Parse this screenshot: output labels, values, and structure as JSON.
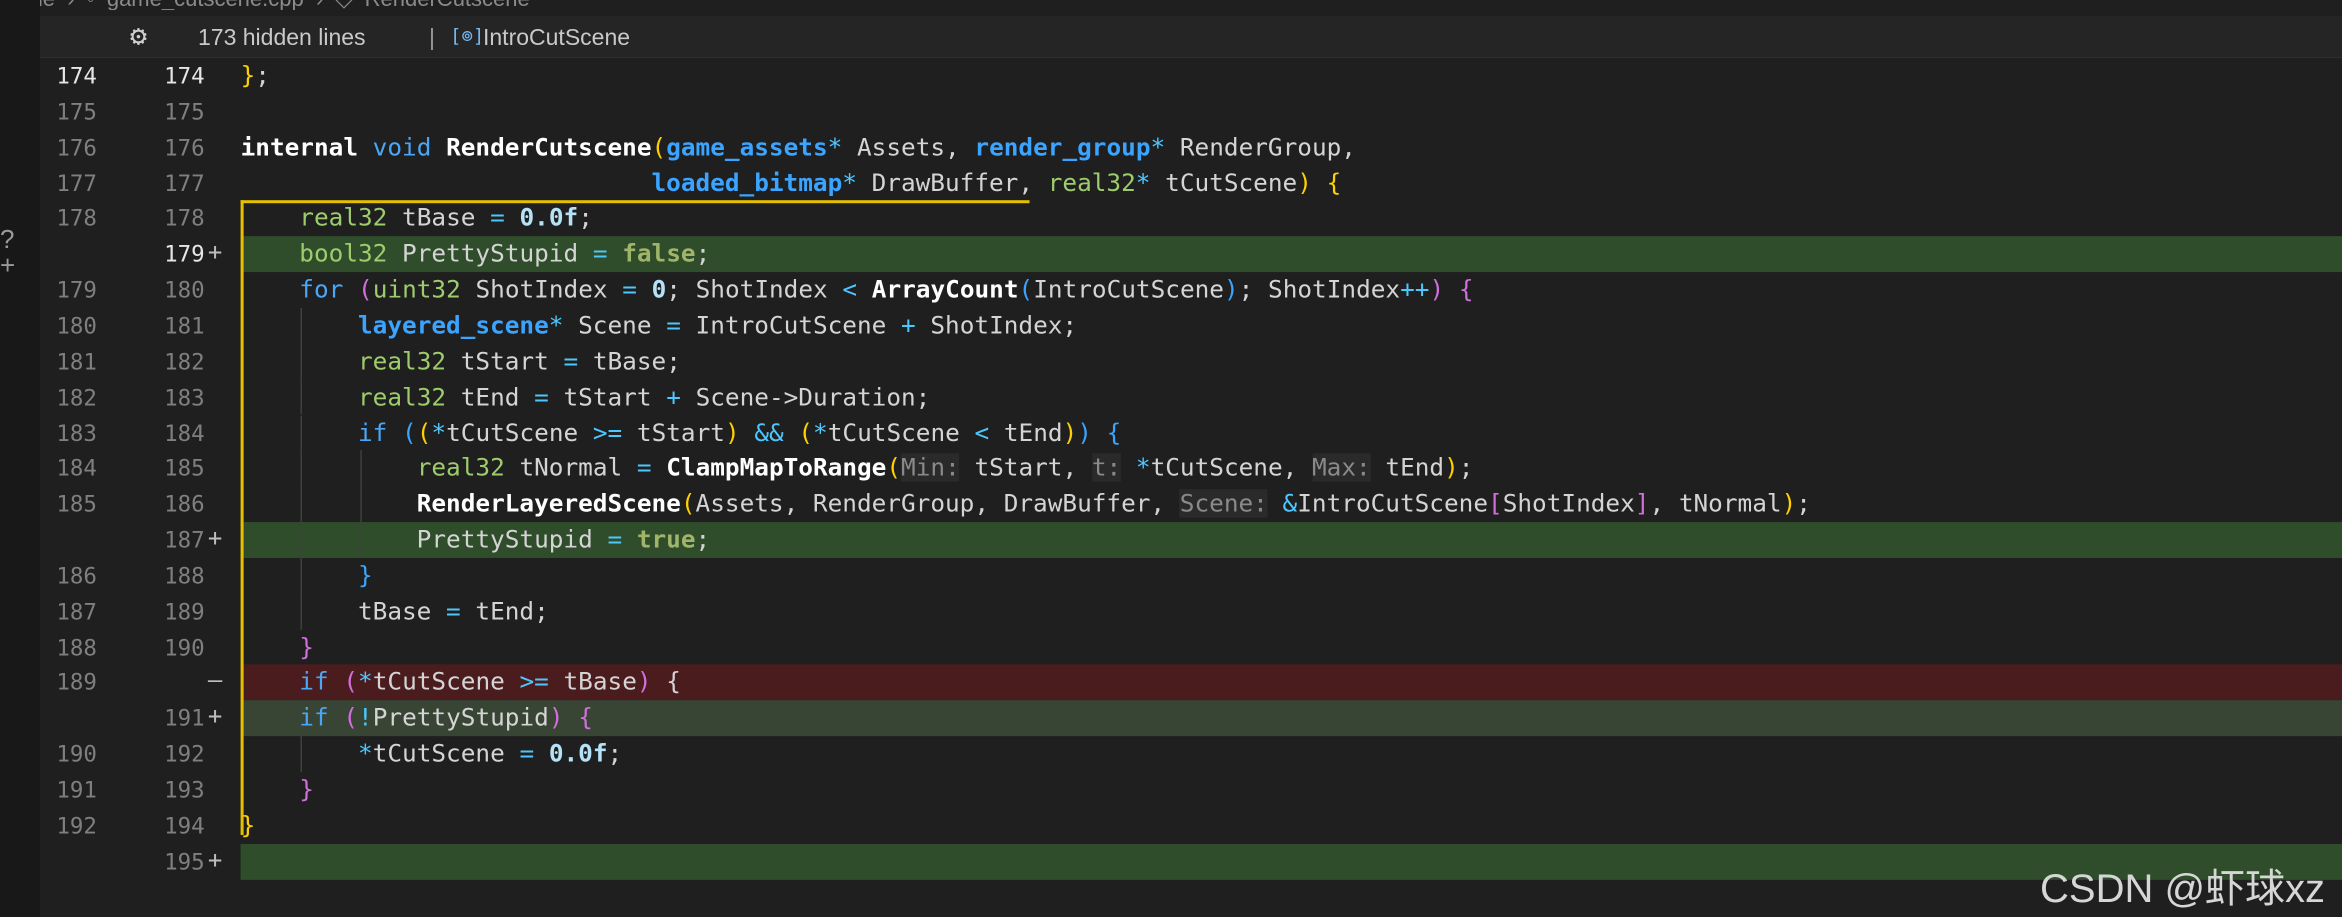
{
  "breadcrumb": "game  ›  ◦  game_cutscene.cpp  ›  ◇  RenderCutscene",
  "sticky": {
    "gear": "⚙",
    "hidden_lines": "173 hidden lines",
    "separator": "|",
    "symbol_icon": "[⊚]",
    "symbol": "IntroCutScene"
  },
  "side_glyph": "?\n+",
  "rows": [
    {
      "a": "174",
      "b": "174",
      "mark": "",
      "type": "normal",
      "cur": true,
      "indent": 0
    },
    {
      "a": "175",
      "b": "175",
      "mark": "",
      "type": "normal",
      "indent": 0
    },
    {
      "a": "176",
      "b": "176",
      "mark": "",
      "type": "normal",
      "indent": 0
    },
    {
      "a": "177",
      "b": "177",
      "mark": "",
      "type": "normal",
      "indent": 0
    },
    {
      "a": "178",
      "b": "178",
      "mark": "",
      "type": "normal",
      "indent": 1
    },
    {
      "a": "",
      "b": "179",
      "mark": "+",
      "type": "added",
      "cur": true,
      "indent": 1
    },
    {
      "a": "179",
      "b": "180",
      "mark": "",
      "type": "normal",
      "indent": 1
    },
    {
      "a": "180",
      "b": "181",
      "mark": "",
      "type": "normal",
      "indent": 2
    },
    {
      "a": "181",
      "b": "182",
      "mark": "",
      "type": "normal",
      "indent": 2
    },
    {
      "a": "182",
      "b": "183",
      "mark": "",
      "type": "normal",
      "indent": 2
    },
    {
      "a": "183",
      "b": "184",
      "mark": "",
      "type": "normal",
      "indent": 2
    },
    {
      "a": "184",
      "b": "185",
      "mark": "",
      "type": "normal",
      "indent": 3
    },
    {
      "a": "185",
      "b": "186",
      "mark": "",
      "type": "normal",
      "indent": 3
    },
    {
      "a": "",
      "b": "187",
      "mark": "+",
      "type": "added",
      "indent": 3
    },
    {
      "a": "186",
      "b": "188",
      "mark": "",
      "type": "normal",
      "indent": 2
    },
    {
      "a": "187",
      "b": "189",
      "mark": "",
      "type": "normal",
      "indent": 2
    },
    {
      "a": "188",
      "b": "190",
      "mark": "",
      "type": "normal",
      "indent": 1
    },
    {
      "a": "189",
      "b": "",
      "mark": "—",
      "type": "removed",
      "indent": 1
    },
    {
      "a": "",
      "b": "191",
      "mark": "+",
      "type": "addedsoft",
      "indent": 1
    },
    {
      "a": "190",
      "b": "192",
      "mark": "",
      "type": "normal",
      "indent": 2
    },
    {
      "a": "191",
      "b": "193",
      "mark": "",
      "type": "normal",
      "indent": 1
    },
    {
      "a": "192",
      "b": "194",
      "mark": "",
      "type": "normal",
      "indent": 0
    },
    {
      "a": "",
      "b": "195",
      "mark": "+",
      "type": "added",
      "indent": 0
    }
  ],
  "code": [
    [
      [
        "t-p1",
        "}"
      ],
      [
        "",
        ";"
      ]
    ],
    [],
    [
      [
        "t-kwb",
        "internal"
      ],
      [
        "",
        " "
      ],
      [
        "t-kw",
        "void"
      ],
      [
        "",
        " "
      ],
      [
        "t-fn",
        "RenderCutscene"
      ],
      [
        "t-p1",
        "("
      ],
      [
        "t-tyb",
        "game_assets"
      ],
      [
        "t-op",
        "*"
      ],
      [
        "",
        " Assets, "
      ],
      [
        "t-tyb",
        "render_group"
      ],
      [
        "t-op",
        "*"
      ],
      [
        "",
        " RenderGroup,"
      ]
    ],
    [
      [
        "",
        "                            "
      ],
      [
        "t-tyb",
        "loaded_bitmap"
      ],
      [
        "t-op",
        "*"
      ],
      [
        "",
        " DrawBuffer, "
      ],
      [
        "t-ty",
        "real32"
      ],
      [
        "t-op",
        "*"
      ],
      [
        "",
        " tCutScene"
      ],
      [
        "t-p1",
        ")"
      ],
      [
        "",
        " "
      ],
      [
        "t-p1",
        "{"
      ]
    ],
    [
      [
        "",
        "    "
      ],
      [
        "t-ty",
        "real32"
      ],
      [
        "",
        " tBase "
      ],
      [
        "t-op",
        "="
      ],
      [
        "",
        " "
      ],
      [
        "t-num",
        "0.0f"
      ],
      [
        "",
        ";"
      ]
    ],
    [
      [
        "",
        "    "
      ],
      [
        "t-ty",
        "bool32"
      ],
      [
        "",
        " PrettyStupid "
      ],
      [
        "t-op",
        "="
      ],
      [
        "",
        " "
      ],
      [
        "t-bool",
        "false"
      ],
      [
        "",
        ";"
      ]
    ],
    [
      [
        "",
        "    "
      ],
      [
        "t-kw",
        "for"
      ],
      [
        "",
        " "
      ],
      [
        "t-p2",
        "("
      ],
      [
        "t-ty",
        "uint32"
      ],
      [
        "",
        " ShotIndex "
      ],
      [
        "t-op",
        "="
      ],
      [
        "",
        " "
      ],
      [
        "t-num",
        "0"
      ],
      [
        "",
        "; ShotIndex "
      ],
      [
        "t-op",
        "<"
      ],
      [
        "",
        " "
      ],
      [
        "t-fn",
        "ArrayCount"
      ],
      [
        "t-p3",
        "("
      ],
      [
        "",
        "IntroCutScene"
      ],
      [
        "t-p3",
        ")"
      ],
      [
        "",
        "; ShotIndex"
      ],
      [
        "t-op",
        "++"
      ],
      [
        "t-p2",
        ")"
      ],
      [
        "",
        " "
      ],
      [
        "t-p2",
        "{"
      ]
    ],
    [
      [
        "",
        "        "
      ],
      [
        "t-tyb",
        "layered_scene"
      ],
      [
        "t-op",
        "*"
      ],
      [
        "",
        " Scene "
      ],
      [
        "t-op",
        "="
      ],
      [
        "",
        " IntroCutScene "
      ],
      [
        "t-op",
        "+"
      ],
      [
        "",
        " ShotIndex;"
      ]
    ],
    [
      [
        "",
        "        "
      ],
      [
        "t-ty",
        "real32"
      ],
      [
        "",
        " tStart "
      ],
      [
        "t-op",
        "="
      ],
      [
        "",
        " tBase;"
      ]
    ],
    [
      [
        "",
        "        "
      ],
      [
        "t-ty",
        "real32"
      ],
      [
        "",
        " tEnd "
      ],
      [
        "t-op",
        "="
      ],
      [
        "",
        " tStart "
      ],
      [
        "t-op",
        "+"
      ],
      [
        "",
        " Scene->Duration;"
      ]
    ],
    [
      [
        "",
        "        "
      ],
      [
        "t-kw",
        "if"
      ],
      [
        "",
        " "
      ],
      [
        "t-p3",
        "("
      ],
      [
        "t-p1",
        "("
      ],
      [
        "t-op",
        "*"
      ],
      [
        "",
        "tCutScene "
      ],
      [
        "t-op",
        ">="
      ],
      [
        "",
        " tStart"
      ],
      [
        "t-p1",
        ")"
      ],
      [
        "",
        " "
      ],
      [
        "t-op",
        "&&"
      ],
      [
        "",
        " "
      ],
      [
        "t-p1",
        "("
      ],
      [
        "t-op",
        "*"
      ],
      [
        "",
        "tCutScene "
      ],
      [
        "t-op",
        "<"
      ],
      [
        "",
        " tEnd"
      ],
      [
        "t-p1",
        ")"
      ],
      [
        "t-p3",
        ")"
      ],
      [
        "",
        " "
      ],
      [
        "t-p3",
        "{"
      ]
    ],
    [
      [
        "",
        "            "
      ],
      [
        "t-ty",
        "real32"
      ],
      [
        "",
        " tNormal "
      ],
      [
        "t-op",
        "="
      ],
      [
        "",
        " "
      ],
      [
        "t-fn",
        "ClampMapToRange"
      ],
      [
        "t-p1",
        "("
      ],
      [
        "t-hint",
        "Min:"
      ],
      [
        "",
        " tStart, "
      ],
      [
        "t-hint",
        "t:"
      ],
      [
        "",
        " "
      ],
      [
        "t-op",
        "*"
      ],
      [
        "",
        "tCutScene, "
      ],
      [
        "t-hint",
        "Max:"
      ],
      [
        "",
        " tEnd"
      ],
      [
        "t-p1",
        ")"
      ],
      [
        "",
        ";"
      ]
    ],
    [
      [
        "",
        "            "
      ],
      [
        "t-fn",
        "RenderLayeredScene"
      ],
      [
        "t-p1",
        "("
      ],
      [
        "",
        "Assets, RenderGroup, DrawBuffer, "
      ],
      [
        "t-hint",
        "Scene:"
      ],
      [
        "",
        " "
      ],
      [
        "t-op",
        "&"
      ],
      [
        "",
        "IntroCutScene"
      ],
      [
        "t-p2",
        "["
      ],
      [
        "",
        "ShotIndex"
      ],
      [
        "t-p2",
        "]"
      ],
      [
        "",
        ", tNormal"
      ],
      [
        "t-p1",
        ")"
      ],
      [
        "",
        ";"
      ]
    ],
    [
      [
        "",
        "            PrettyStupid "
      ],
      [
        "t-op",
        "="
      ],
      [
        "",
        " "
      ],
      [
        "t-bool",
        "true"
      ],
      [
        "",
        ";"
      ]
    ],
    [
      [
        "",
        "        "
      ],
      [
        "t-p3",
        "}"
      ]
    ],
    [
      [
        "",
        "        tBase "
      ],
      [
        "t-op",
        "="
      ],
      [
        "",
        " tEnd;"
      ]
    ],
    [
      [
        "",
        "    "
      ],
      [
        "t-p2",
        "}"
      ]
    ],
    [
      [
        "",
        "    "
      ],
      [
        "t-kw",
        "if"
      ],
      [
        "",
        " "
      ],
      [
        "t-p2",
        "("
      ],
      [
        "t-op",
        "*"
      ],
      [
        "",
        "tCutScene "
      ],
      [
        "t-op",
        ">="
      ],
      [
        "",
        " tBase"
      ],
      [
        "t-p2",
        ")"
      ],
      [
        "",
        " {"
      ]
    ],
    [
      [
        "",
        "    "
      ],
      [
        "t-kw",
        "if"
      ],
      [
        "",
        " "
      ],
      [
        "t-p2",
        "("
      ],
      [
        "t-op",
        "!"
      ],
      [
        "",
        "PrettyStupid"
      ],
      [
        "t-p2",
        ")"
      ],
      [
        "",
        " "
      ],
      [
        "t-p2",
        "{"
      ]
    ],
    [
      [
        "",
        "        "
      ],
      [
        "t-op",
        "*"
      ],
      [
        "",
        "tCutScene "
      ],
      [
        "t-op",
        "="
      ],
      [
        "",
        " "
      ],
      [
        "t-num",
        "0.0f"
      ],
      [
        "",
        ";"
      ]
    ],
    [
      [
        "",
        "    "
      ],
      [
        "t-p2",
        "}"
      ]
    ],
    [
      [
        "t-p1",
        "}"
      ]
    ],
    []
  ],
  "watermark": "CSDN @虾球xz"
}
